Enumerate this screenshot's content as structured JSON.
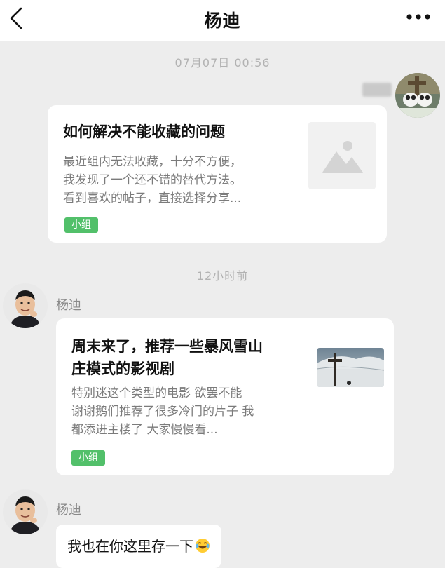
{
  "header": {
    "title": "杨迪",
    "back_icon": "chevron-left-icon",
    "more_icon": "more-horizontal-icon"
  },
  "messages": [
    {
      "type": "timestamp",
      "text": "07月07日 00:56"
    },
    {
      "type": "shared_post",
      "direction": "outgoing",
      "title": "如何解决不能收藏的问题",
      "description_lines": [
        "最近组内无法收藏，十分不方便，",
        "我发现了一个还不错的替代方法。",
        "看到喜欢的帖子，直接选择分享..."
      ],
      "tag": "小组",
      "thumbnail": "image-placeholder-icon"
    },
    {
      "type": "timestamp",
      "text": "12小时前"
    },
    {
      "type": "shared_post",
      "direction": "incoming",
      "sender": "杨迪",
      "title_lines": [
        "周末来了，推荐一些暴风雪山",
        "庄模式的影视剧"
      ],
      "description_lines": [
        "特别迷这个类型的电影 欲罢不能",
        "谢谢鹅们推荐了很多冷门的片子 我",
        "都添进主楼了 大家慢慢看..."
      ],
      "tag": "小组",
      "thumbnail": "snowy-mountain-cross-photo"
    },
    {
      "type": "text",
      "direction": "incoming",
      "sender": "杨迪",
      "text": "我也在你这里存一下",
      "emoji": "tears-of-joy-emoji"
    }
  ],
  "colors": {
    "background": "#ededed",
    "card": "#ffffff",
    "tag_green": "#52c06a",
    "timestamp": "#b2b2b2",
    "secondary_text": "#7b7b7b"
  }
}
